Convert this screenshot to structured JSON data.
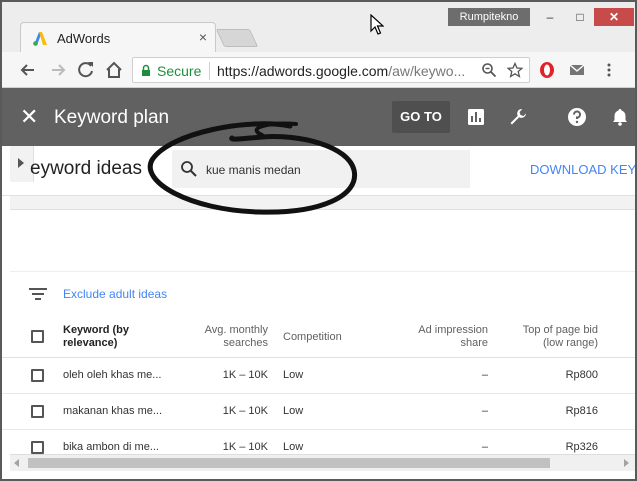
{
  "window": {
    "profile_name": "Rumpitekno",
    "minimize": "–",
    "maximize": "□",
    "close": "✕"
  },
  "tab": {
    "title": "AdWords",
    "close": "×"
  },
  "addressbar": {
    "secure_label": "Secure",
    "url_host": "https://adwords.google.com",
    "url_path": "/aw/keywo..."
  },
  "header": {
    "close": "✕",
    "title": "Keyword plan",
    "goto_label": "GO TO"
  },
  "ideas": {
    "title": "eyword ideas",
    "search_query": "kue manis medan",
    "download_label": "DOWNLOAD KEY"
  },
  "filter": {
    "exclude_label": "Exclude adult ideas"
  },
  "table": {
    "headers": {
      "keyword_line1": "Keyword (by",
      "keyword_line2": "relevance)",
      "searches_line1": "Avg. monthly",
      "searches_line2": "searches",
      "competition": "Competition",
      "impression_line1": "Ad impression",
      "impression_line2": "share",
      "bid_line1": "Top of page bid",
      "bid_line2": "(low range)"
    },
    "rows": [
      {
        "keyword": "oleh oleh khas me...",
        "searches": "1K – 10K",
        "competition": "Low",
        "impression": "–",
        "bid": "Rp800"
      },
      {
        "keyword": "makanan khas me...",
        "searches": "1K – 10K",
        "competition": "Low",
        "impression": "–",
        "bid": "Rp816"
      },
      {
        "keyword": "bika ambon di me...",
        "searches": "1K – 10K",
        "competition": "Low",
        "impression": "–",
        "bid": "Rp326"
      }
    ]
  },
  "colors": {
    "header_bg": "#616161",
    "link_blue": "#4285f4",
    "secure_green": "#1e8e3e"
  }
}
